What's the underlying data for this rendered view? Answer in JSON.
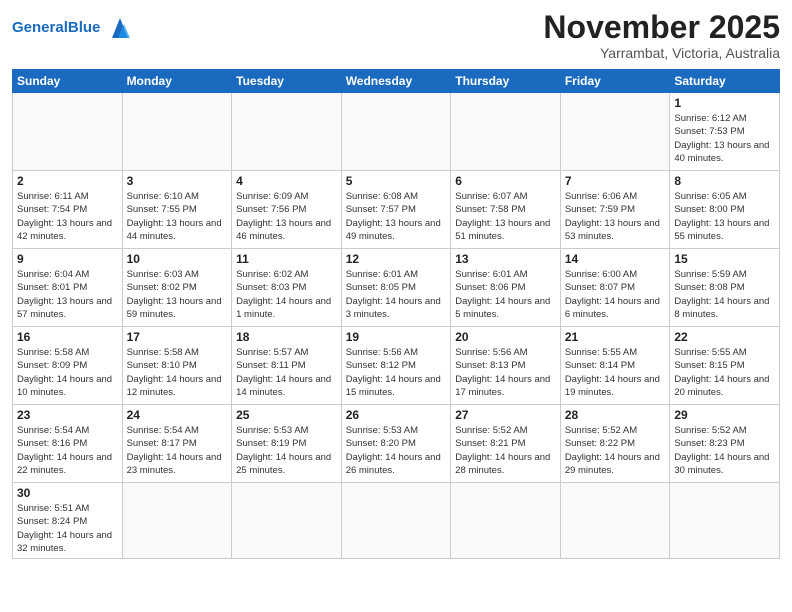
{
  "header": {
    "logo_general": "General",
    "logo_blue": "Blue",
    "month": "November 2025",
    "location": "Yarrambat, Victoria, Australia"
  },
  "days_of_week": [
    "Sunday",
    "Monday",
    "Tuesday",
    "Wednesday",
    "Thursday",
    "Friday",
    "Saturday"
  ],
  "weeks": [
    [
      {
        "day": "",
        "info": ""
      },
      {
        "day": "",
        "info": ""
      },
      {
        "day": "",
        "info": ""
      },
      {
        "day": "",
        "info": ""
      },
      {
        "day": "",
        "info": ""
      },
      {
        "day": "",
        "info": ""
      },
      {
        "day": "1",
        "sunrise": "Sunrise: 6:12 AM",
        "sunset": "Sunset: 7:53 PM",
        "daylight": "Daylight: 13 hours and 40 minutes."
      }
    ],
    [
      {
        "day": "2",
        "sunrise": "Sunrise: 6:11 AM",
        "sunset": "Sunset: 7:54 PM",
        "daylight": "Daylight: 13 hours and 42 minutes."
      },
      {
        "day": "3",
        "sunrise": "Sunrise: 6:10 AM",
        "sunset": "Sunset: 7:55 PM",
        "daylight": "Daylight: 13 hours and 44 minutes."
      },
      {
        "day": "4",
        "sunrise": "Sunrise: 6:09 AM",
        "sunset": "Sunset: 7:56 PM",
        "daylight": "Daylight: 13 hours and 46 minutes."
      },
      {
        "day": "5",
        "sunrise": "Sunrise: 6:08 AM",
        "sunset": "Sunset: 7:57 PM",
        "daylight": "Daylight: 13 hours and 49 minutes."
      },
      {
        "day": "6",
        "sunrise": "Sunrise: 6:07 AM",
        "sunset": "Sunset: 7:58 PM",
        "daylight": "Daylight: 13 hours and 51 minutes."
      },
      {
        "day": "7",
        "sunrise": "Sunrise: 6:06 AM",
        "sunset": "Sunset: 7:59 PM",
        "daylight": "Daylight: 13 hours and 53 minutes."
      },
      {
        "day": "8",
        "sunrise": "Sunrise: 6:05 AM",
        "sunset": "Sunset: 8:00 PM",
        "daylight": "Daylight: 13 hours and 55 minutes."
      }
    ],
    [
      {
        "day": "9",
        "sunrise": "Sunrise: 6:04 AM",
        "sunset": "Sunset: 8:01 PM",
        "daylight": "Daylight: 13 hours and 57 minutes."
      },
      {
        "day": "10",
        "sunrise": "Sunrise: 6:03 AM",
        "sunset": "Sunset: 8:02 PM",
        "daylight": "Daylight: 13 hours and 59 minutes."
      },
      {
        "day": "11",
        "sunrise": "Sunrise: 6:02 AM",
        "sunset": "Sunset: 8:03 PM",
        "daylight": "Daylight: 14 hours and 1 minute."
      },
      {
        "day": "12",
        "sunrise": "Sunrise: 6:01 AM",
        "sunset": "Sunset: 8:05 PM",
        "daylight": "Daylight: 14 hours and 3 minutes."
      },
      {
        "day": "13",
        "sunrise": "Sunrise: 6:01 AM",
        "sunset": "Sunset: 8:06 PM",
        "daylight": "Daylight: 14 hours and 5 minutes."
      },
      {
        "day": "14",
        "sunrise": "Sunrise: 6:00 AM",
        "sunset": "Sunset: 8:07 PM",
        "daylight": "Daylight: 14 hours and 6 minutes."
      },
      {
        "day": "15",
        "sunrise": "Sunrise: 5:59 AM",
        "sunset": "Sunset: 8:08 PM",
        "daylight": "Daylight: 14 hours and 8 minutes."
      }
    ],
    [
      {
        "day": "16",
        "sunrise": "Sunrise: 5:58 AM",
        "sunset": "Sunset: 8:09 PM",
        "daylight": "Daylight: 14 hours and 10 minutes."
      },
      {
        "day": "17",
        "sunrise": "Sunrise: 5:58 AM",
        "sunset": "Sunset: 8:10 PM",
        "daylight": "Daylight: 14 hours and 12 minutes."
      },
      {
        "day": "18",
        "sunrise": "Sunrise: 5:57 AM",
        "sunset": "Sunset: 8:11 PM",
        "daylight": "Daylight: 14 hours and 14 minutes."
      },
      {
        "day": "19",
        "sunrise": "Sunrise: 5:56 AM",
        "sunset": "Sunset: 8:12 PM",
        "daylight": "Daylight: 14 hours and 15 minutes."
      },
      {
        "day": "20",
        "sunrise": "Sunrise: 5:56 AM",
        "sunset": "Sunset: 8:13 PM",
        "daylight": "Daylight: 14 hours and 17 minutes."
      },
      {
        "day": "21",
        "sunrise": "Sunrise: 5:55 AM",
        "sunset": "Sunset: 8:14 PM",
        "daylight": "Daylight: 14 hours and 19 minutes."
      },
      {
        "day": "22",
        "sunrise": "Sunrise: 5:55 AM",
        "sunset": "Sunset: 8:15 PM",
        "daylight": "Daylight: 14 hours and 20 minutes."
      }
    ],
    [
      {
        "day": "23",
        "sunrise": "Sunrise: 5:54 AM",
        "sunset": "Sunset: 8:16 PM",
        "daylight": "Daylight: 14 hours and 22 minutes."
      },
      {
        "day": "24",
        "sunrise": "Sunrise: 5:54 AM",
        "sunset": "Sunset: 8:17 PM",
        "daylight": "Daylight: 14 hours and 23 minutes."
      },
      {
        "day": "25",
        "sunrise": "Sunrise: 5:53 AM",
        "sunset": "Sunset: 8:19 PM",
        "daylight": "Daylight: 14 hours and 25 minutes."
      },
      {
        "day": "26",
        "sunrise": "Sunrise: 5:53 AM",
        "sunset": "Sunset: 8:20 PM",
        "daylight": "Daylight: 14 hours and 26 minutes."
      },
      {
        "day": "27",
        "sunrise": "Sunrise: 5:52 AM",
        "sunset": "Sunset: 8:21 PM",
        "daylight": "Daylight: 14 hours and 28 minutes."
      },
      {
        "day": "28",
        "sunrise": "Sunrise: 5:52 AM",
        "sunset": "Sunset: 8:22 PM",
        "daylight": "Daylight: 14 hours and 29 minutes."
      },
      {
        "day": "29",
        "sunrise": "Sunrise: 5:52 AM",
        "sunset": "Sunset: 8:23 PM",
        "daylight": "Daylight: 14 hours and 30 minutes."
      }
    ],
    [
      {
        "day": "30",
        "sunrise": "Sunrise: 5:51 AM",
        "sunset": "Sunset: 8:24 PM",
        "daylight": "Daylight: 14 hours and 32 minutes."
      },
      {
        "day": "",
        "info": ""
      },
      {
        "day": "",
        "info": ""
      },
      {
        "day": "",
        "info": ""
      },
      {
        "day": "",
        "info": ""
      },
      {
        "day": "",
        "info": ""
      },
      {
        "day": "",
        "info": ""
      }
    ]
  ]
}
